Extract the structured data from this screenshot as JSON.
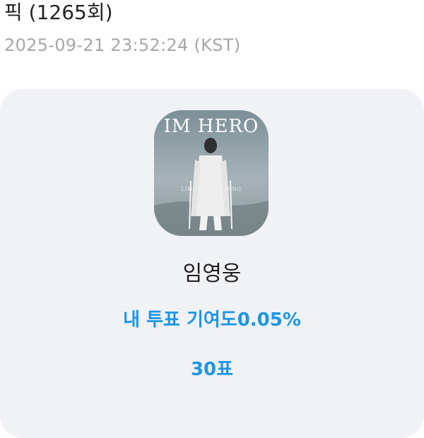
{
  "header": {
    "title": "픽 (1265회)",
    "timestamp": "2025-09-21 23:52:24 (KST)"
  },
  "card": {
    "album_cover": {
      "title_text": "IM HERO",
      "artist_text": "LIM YOUNG WOONG"
    },
    "artist_name": "임영웅",
    "contribution_text": "내 투표 기여도0.05%",
    "votes_text": "30표"
  },
  "colors": {
    "accent": "#1e96e6",
    "card_bg": "#f1f2f6",
    "timestamp": "#a6a6ab"
  }
}
